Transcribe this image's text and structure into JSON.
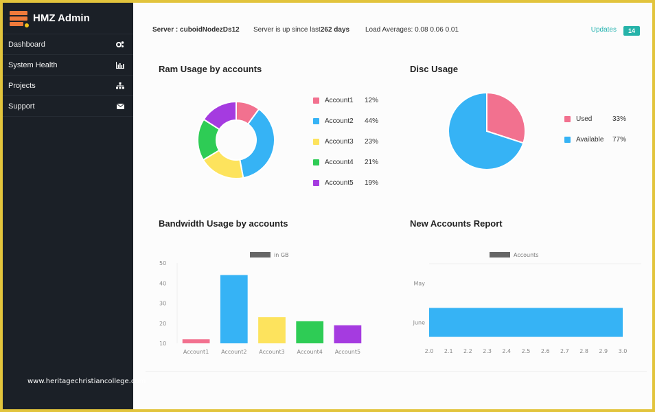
{
  "app": {
    "title": "HMZ Admin"
  },
  "sidebar": {
    "items": [
      {
        "label": "Dashboard",
        "icon": "gears-icon"
      },
      {
        "label": "System Health",
        "icon": "bar-chart-icon"
      },
      {
        "label": "Projects",
        "icon": "sitemap-icon"
      },
      {
        "label": "Support",
        "icon": "envelope-icon"
      }
    ]
  },
  "watermark": "www.heritagechristiancollege.com",
  "topbar": {
    "server": "Server : cuboidNodezDs12",
    "uptime_prefix": "Server is up since last",
    "uptime_value": "262 days",
    "load": "Load Averages: 0.08 0.06 0.01",
    "updates_label": "Updates",
    "updates_count": "14"
  },
  "colors": {
    "pink": "#f2718f",
    "blue": "#36b3f5",
    "yellow": "#fde35d",
    "green": "#2ecc55",
    "purple": "#a53be0",
    "accent": "#26b3a9"
  },
  "chart_data": [
    {
      "type": "pie",
      "variant": "doughnut",
      "title": "Ram Usage by accounts",
      "categories": [
        "Account1",
        "Account2",
        "Account3",
        "Account4",
        "Account5"
      ],
      "values": [
        12,
        44,
        23,
        21,
        19
      ],
      "labels": [
        "12%",
        "44%",
        "23%",
        "21%",
        "19%"
      ],
      "colors": [
        "#f2718f",
        "#36b3f5",
        "#fde35d",
        "#2ecc55",
        "#a53be0"
      ],
      "legend": "right"
    },
    {
      "type": "pie",
      "title": "Disc Usage",
      "categories": [
        "Used",
        "Available"
      ],
      "values": [
        33,
        77
      ],
      "labels": [
        "33%",
        "77%"
      ],
      "colors": [
        "#f2718f",
        "#36b3f5"
      ],
      "legend": "right"
    },
    {
      "type": "bar",
      "title": "Bandwidth Usage by accounts",
      "legend_label": "in GB",
      "legend": "top",
      "categories": [
        "Account1",
        "Account2",
        "Account3",
        "Account4",
        "Account5"
      ],
      "values": [
        12,
        44,
        23,
        21,
        19
      ],
      "colors": [
        "#f2718f",
        "#36b3f5",
        "#fde35d",
        "#2ecc55",
        "#a53be0"
      ],
      "ylim": [
        10,
        50
      ],
      "yticks": [
        10,
        20,
        30,
        40,
        50
      ],
      "xlabel": "",
      "ylabel": ""
    },
    {
      "type": "bar",
      "orientation": "horizontal",
      "title": "New Accounts Report",
      "legend_label": "Accounts",
      "legend": "top",
      "categories": [
        "May",
        "June"
      ],
      "values": [
        null,
        3.0
      ],
      "colors": [
        "#36b3f5",
        "#36b3f5"
      ],
      "xlim": [
        2.0,
        3.0
      ],
      "xticks": [
        "2.0",
        "2.1",
        "2.2",
        "2.3",
        "2.4",
        "2.5",
        "2.6",
        "2.7",
        "2.8",
        "2.9",
        "3.0"
      ],
      "xlabel": "",
      "ylabel": ""
    }
  ]
}
